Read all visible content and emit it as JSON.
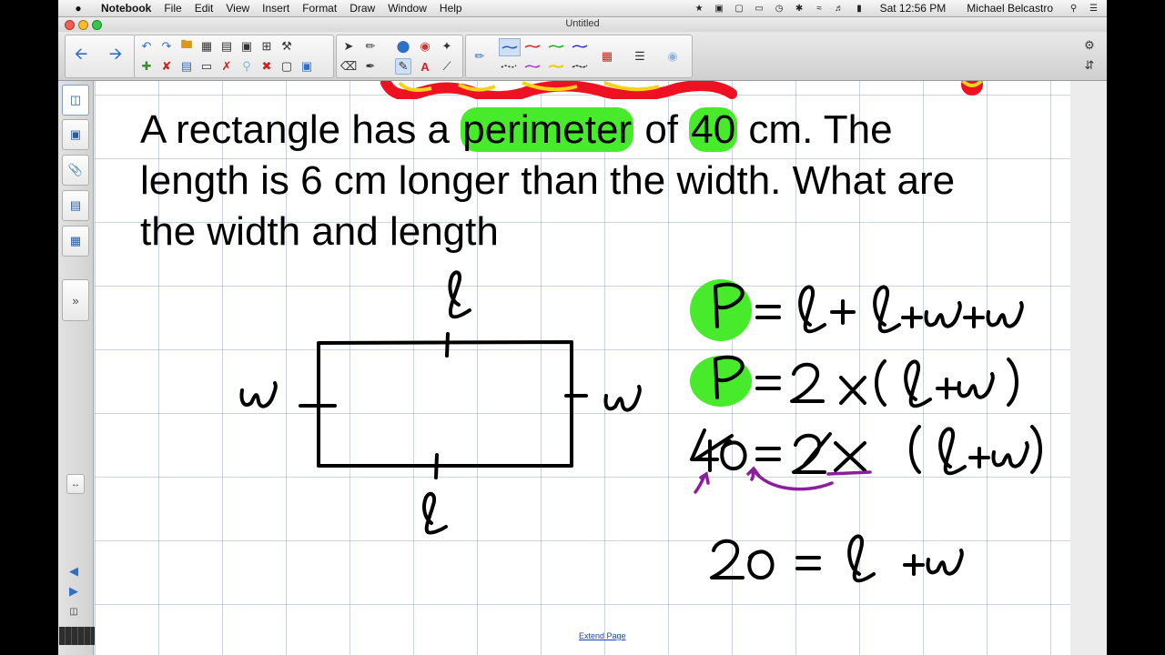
{
  "menubar": {
    "app_name": "Notebook",
    "items": [
      "File",
      "Edit",
      "View",
      "Insert",
      "Format",
      "Draw",
      "Window",
      "Help"
    ],
    "clock": "Sat 12:56 PM",
    "user": "Michael Belcastro"
  },
  "window": {
    "title": "Untitled"
  },
  "problem": {
    "line1_a": "A rectangle has a ",
    "line1_hl1": "perimeter",
    "line1_b": " of ",
    "line1_hl2": "40",
    "line1_c": " cm.  The",
    "line2": "length is 6 cm longer than the width. What are",
    "line3": "the width and length"
  },
  "page": {
    "extend_link": "Extend Page"
  },
  "colors": {
    "highlight": "#48ea2c",
    "ink": "#000000",
    "annotation": "#8b1e9c",
    "grid": "#9aa8bf"
  }
}
